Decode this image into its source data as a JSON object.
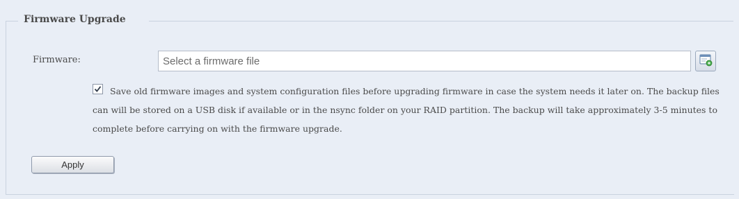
{
  "section": {
    "title": "Firmware Upgrade"
  },
  "firmware_field": {
    "label": "Firmware:",
    "value": "",
    "placeholder": "Select a firmware file"
  },
  "browse_button": {
    "icon": "file-browse-icon",
    "accent_color": "#3a8fd0"
  },
  "backup_option": {
    "checked": true,
    "text": "Save old firmware images and system configuration files before upgrading firmware in case the system needs it later on. The backup files can will be stored on a USB disk if available or in the nsync folder on your RAID partition. The backup will take approximately 3-5 minutes to complete before carrying on with the firmware upgrade."
  },
  "actions": {
    "apply_label": "Apply"
  }
}
